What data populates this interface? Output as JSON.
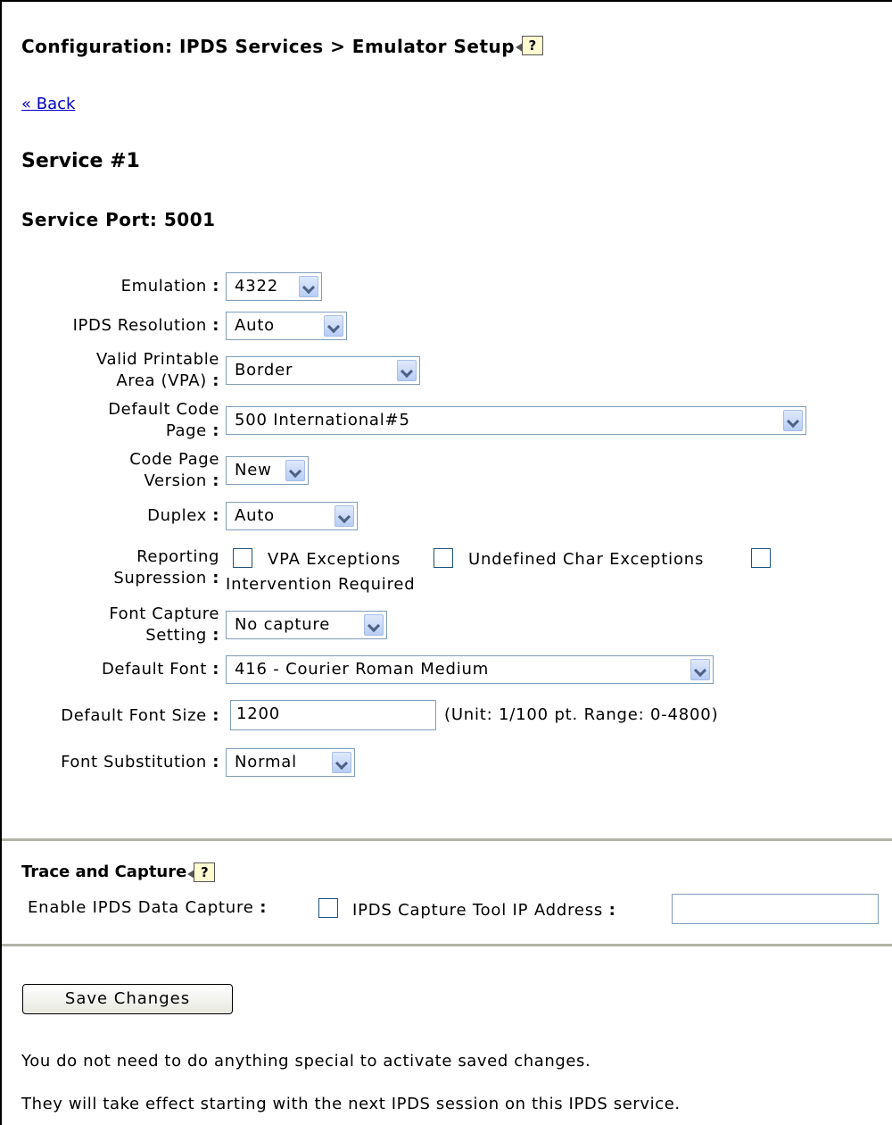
{
  "header": {
    "title": "Configuration: IPDS Services > Emulator Setup",
    "help_glyph": "?",
    "back_link": "« Back"
  },
  "service": {
    "heading": "Service #1",
    "port_label": "Service Port: 5001"
  },
  "form": {
    "emulation": {
      "label": "Emulation",
      "value": "4322"
    },
    "ipds_resolution": {
      "label": "IPDS Resolution",
      "value": "Auto"
    },
    "vpa": {
      "label_line1": "Valid Printable",
      "label_line2": "Area (VPA)",
      "value": "Border"
    },
    "default_code_page": {
      "label_line1": "Default Code",
      "label_line2": "Page",
      "value": "500 International#5"
    },
    "code_page_version": {
      "label_line1": "Code Page",
      "label_line2": "Version",
      "value": "New"
    },
    "duplex": {
      "label": "Duplex",
      "value": "Auto"
    },
    "reporting_supression": {
      "label_line1": "Reporting",
      "label_line2": "Supression",
      "options": [
        "VPA Exceptions",
        "Undefined Char Exceptions",
        "Intervention Required"
      ]
    },
    "font_capture": {
      "label_line1": "Font Capture",
      "label_line2": "Setting",
      "value": "No capture"
    },
    "default_font": {
      "label": "Default Font",
      "value": "416 - Courier Roman Medium"
    },
    "default_font_size": {
      "label": "Default Font Size",
      "value": "1200",
      "hint": "(Unit: 1/100 pt. Range: 0-4800)"
    },
    "font_substitution": {
      "label": "Font Substitution",
      "value": "Normal"
    },
    "colon": ":"
  },
  "trace": {
    "heading": "Trace and Capture",
    "enable_label": "Enable IPDS Data Capture",
    "ip_label": "IPDS Capture Tool IP Address",
    "ip_value": ""
  },
  "actions": {
    "save_label": "Save Changes"
  },
  "notes": {
    "line1": "You do not need to do anything special to activate saved changes.",
    "line2": "They will take effect starting with the next IPDS session on this IPDS service."
  },
  "colors": {
    "link": "#0000cc",
    "rule": "#b3b3a8",
    "field_border": "#7f9db9",
    "dropdown_button": "#b8cdf5"
  }
}
